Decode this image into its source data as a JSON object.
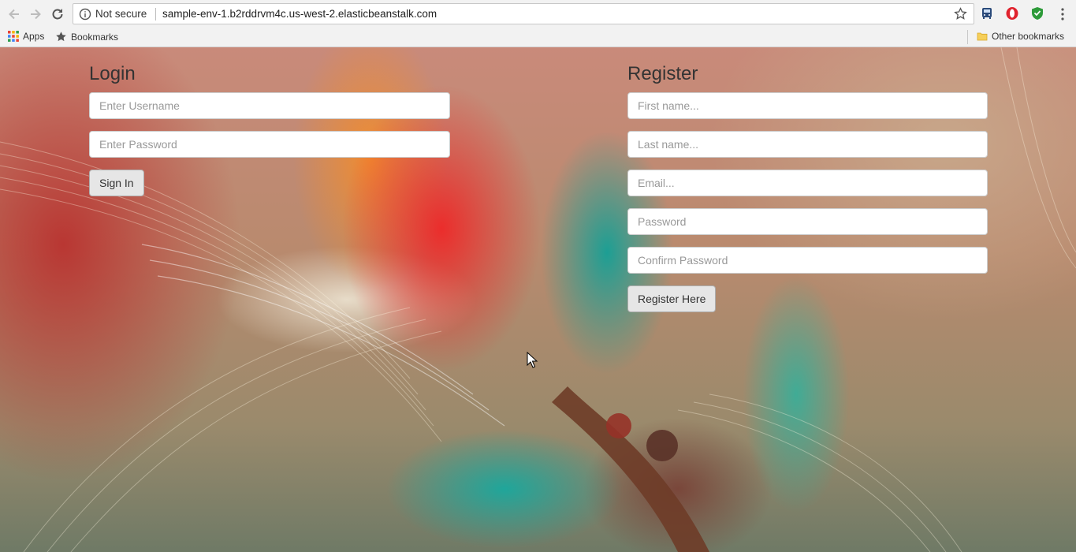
{
  "browser": {
    "security_label": "Not secure",
    "url": "sample-env-1.b2rddrvm4c.us-west-2.elasticbeanstalk.com",
    "bookmarks": {
      "apps_label": "Apps",
      "bookmarks_label": "Bookmarks",
      "other_label": "Other bookmarks"
    }
  },
  "login": {
    "title": "Login",
    "username_placeholder": "Enter Username",
    "password_placeholder": "Enter Password",
    "submit_label": "Sign In"
  },
  "register": {
    "title": "Register",
    "first_name_placeholder": "First name...",
    "last_name_placeholder": "Last name...",
    "email_placeholder": "Email...",
    "password_placeholder": "Password",
    "confirm_placeholder": "Confirm Password",
    "submit_label": "Register Here"
  }
}
